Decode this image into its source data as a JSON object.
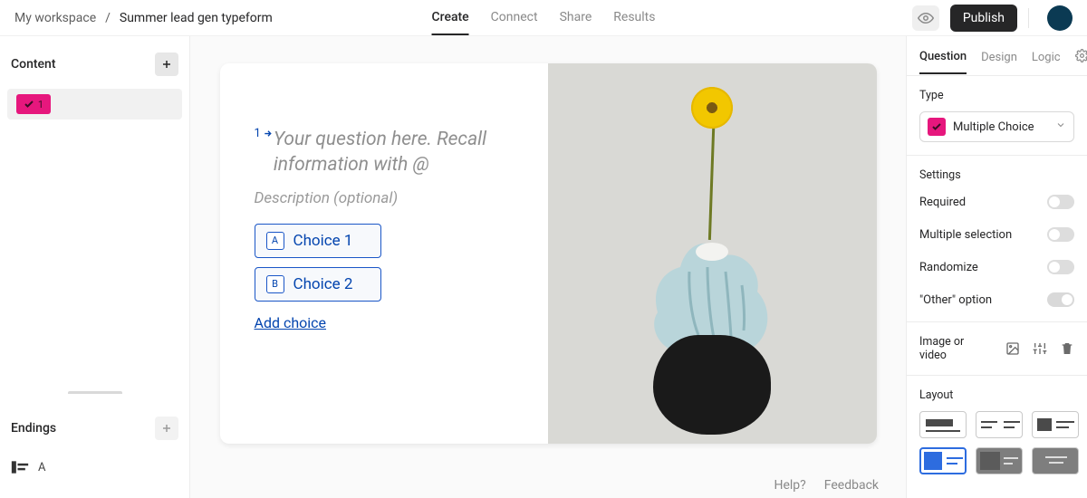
{
  "breadcrumb": {
    "workspace": "My workspace",
    "project": "Summer lead gen typeform"
  },
  "top_tabs": {
    "create": "Create",
    "connect": "Connect",
    "share": "Share",
    "results": "Results",
    "active": "create"
  },
  "top_right": {
    "publish": "Publish"
  },
  "left": {
    "content_label": "Content",
    "endings_label": "Endings",
    "q1_number": "1",
    "ending_letter": "A"
  },
  "canvas": {
    "q_number": "1",
    "title_placeholder": "Your question here. Recall information with @",
    "desc_placeholder": "Description (optional)",
    "choices": [
      {
        "key": "A",
        "label": "Choice 1"
      },
      {
        "key": "B",
        "label": "Choice 2"
      }
    ],
    "add_choice": "Add choice"
  },
  "footer": {
    "help": "Help?",
    "feedback": "Feedback"
  },
  "right": {
    "tabs": {
      "question": "Question",
      "design": "Design",
      "logic": "Logic"
    },
    "type_label": "Type",
    "type_value": "Multiple Choice",
    "settings_label": "Settings",
    "settings": {
      "required": "Required",
      "multiple": "Multiple selection",
      "randomize": "Randomize",
      "other": "\"Other\" option"
    },
    "media_label": "Image or video",
    "layout_label": "Layout"
  },
  "colors": {
    "accent_pink": "#e6177d",
    "link_blue": "#0445af"
  }
}
